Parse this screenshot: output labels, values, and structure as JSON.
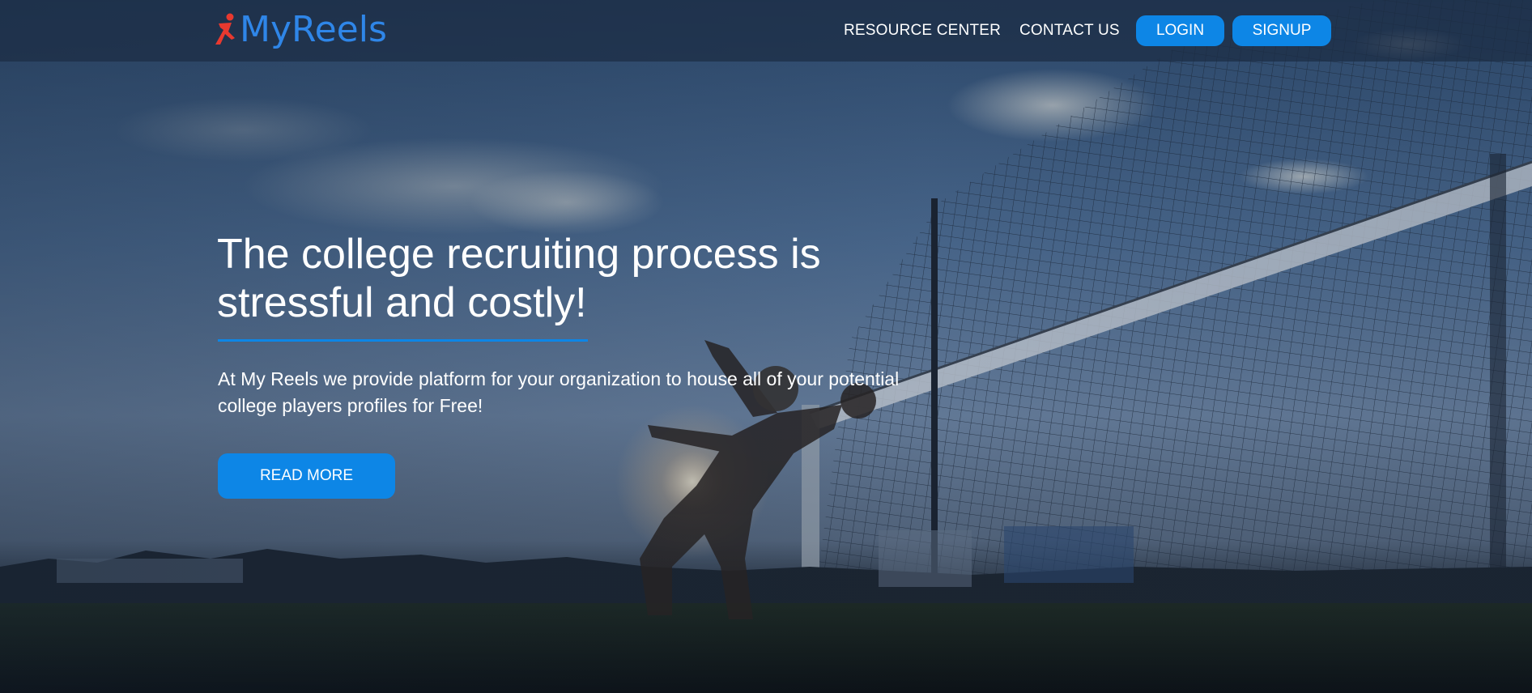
{
  "header": {
    "logo_text": "MyReels",
    "nav": {
      "resource_center": "RESOURCE CENTER",
      "contact_us": "CONTACT US"
    },
    "login_label": "LOGIN",
    "signup_label": "SIGNUP"
  },
  "hero": {
    "title": "The college recruiting process is stressful and costly!",
    "subtitle": "At My Reels we provide platform for your organization to house all of your potential college players profiles for Free!",
    "cta_label": "READ MORE",
    "background_image": "soccer-player-heading-ball-in-front-of-goal-net"
  },
  "colors": {
    "accent": "#0d86e6",
    "logo_blue": "#2f86e8",
    "logo_red": "#e8392f",
    "header_bg": "#1c2d44"
  }
}
